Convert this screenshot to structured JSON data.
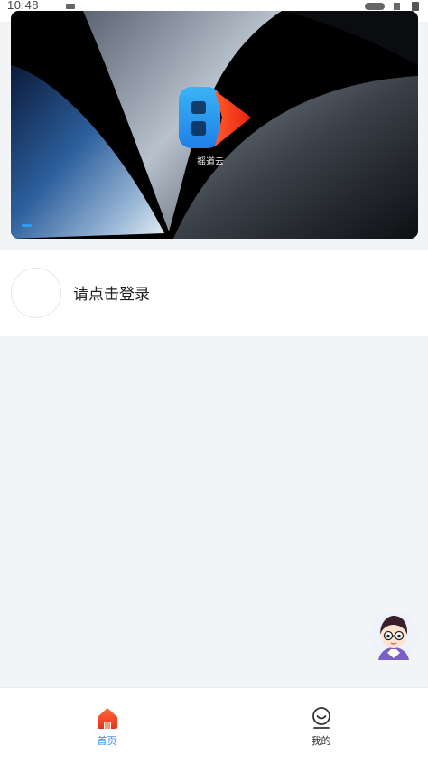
{
  "status_bar": {
    "time": "10:48"
  },
  "banner": {
    "logo_caption": "摇道云",
    "slide_index": 1
  },
  "login": {
    "prompt": "请点击登录"
  },
  "tabbar": {
    "active_color": "#3d8fe0",
    "tabs": [
      {
        "label": "首页",
        "icon": "home-icon",
        "active": true
      },
      {
        "label": "我的",
        "icon": "smiley-profile-icon",
        "active": false
      }
    ]
  }
}
